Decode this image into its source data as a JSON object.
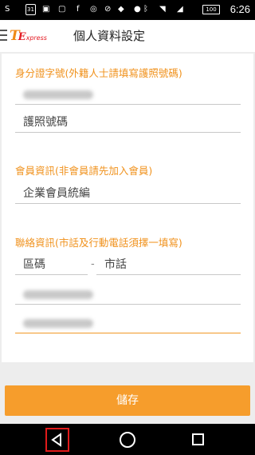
{
  "statusbar": {
    "icons": [
      "s-icon",
      "calendar-icon",
      "image-icon",
      "notification-icon",
      "facebook-icon",
      "whatsapp-icon",
      "block-icon",
      "android-icon",
      "location-icon",
      "bluetooth-icon",
      "wifi-icon",
      "signal-icon"
    ],
    "calendar_text": "31",
    "battery_text": "100",
    "time": "6:26"
  },
  "header": {
    "logo": "TExpress",
    "title": "個人資料設定"
  },
  "form": {
    "id_section_label": "身分證字號(外籍人士請填寫護照號碼)",
    "passport_placeholder": "護照號碼",
    "member_section_label": "會員資訊(非會員請先加入會員)",
    "company_id_placeholder": "企業會員統編",
    "contact_section_label": "聯絡資訊(市話及行動電話須擇一填寫)",
    "area_code_placeholder": "區碼",
    "separator": "-",
    "landline_placeholder": "市話"
  },
  "actions": {
    "save_label": "儲存"
  },
  "colors": {
    "accent": "#f0921d",
    "button": "#f69d2c",
    "highlight": "#e01a1a"
  }
}
